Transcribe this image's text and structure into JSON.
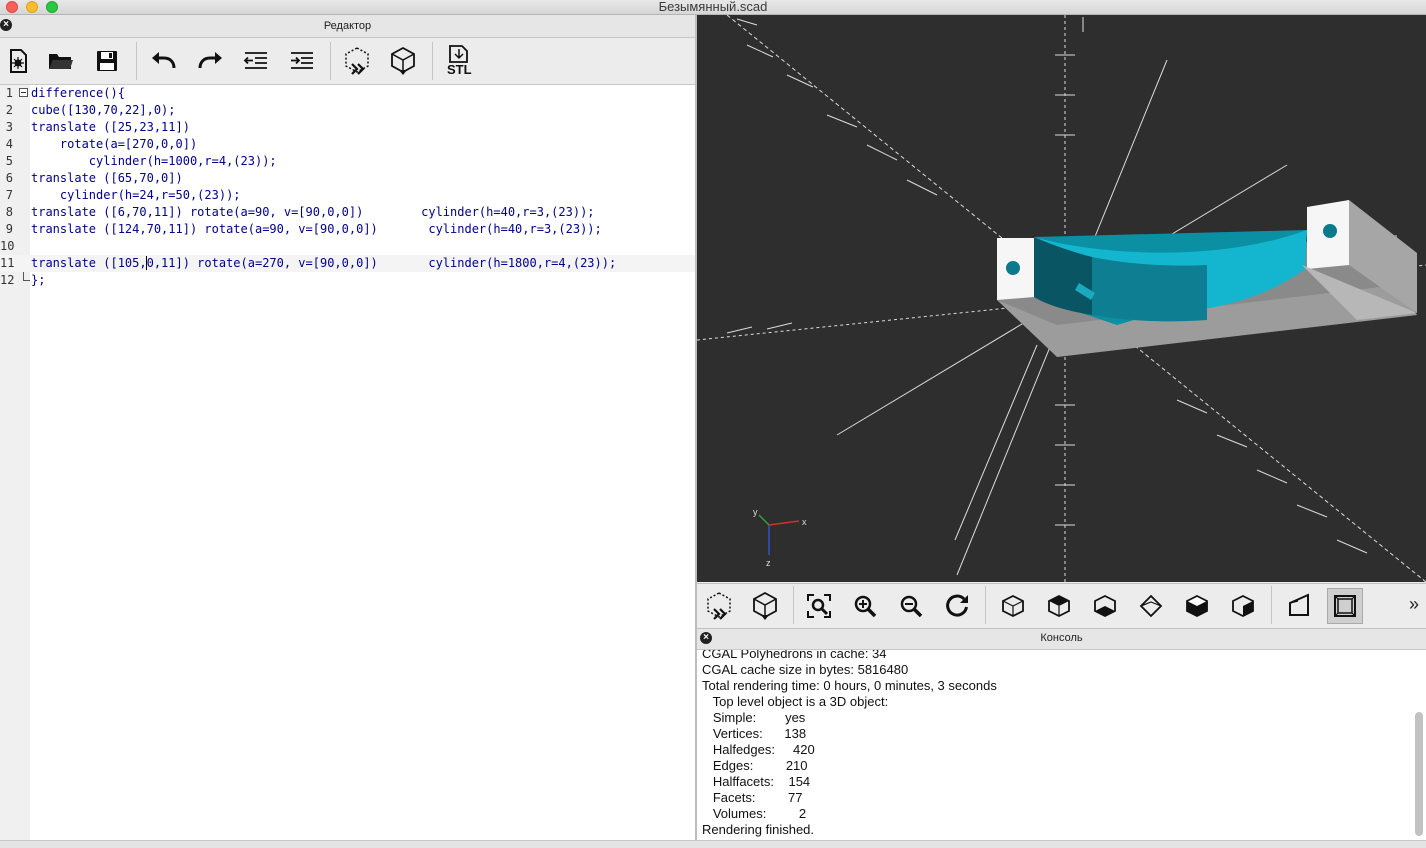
{
  "window": {
    "title": "Безымянный.scad"
  },
  "editor": {
    "title": "Редактор",
    "toolbar": [
      "new-file-icon",
      "open-folder-icon",
      "save-icon",
      "undo-icon",
      "redo-icon",
      "unindent-icon",
      "indent-icon",
      "preview-icon",
      "render-icon",
      "export-stl-icon"
    ],
    "stl_label": "STL",
    "lines": [
      {
        "n": "1",
        "text": "difference(){"
      },
      {
        "n": "2",
        "text": "cube([130,70,22],0);"
      },
      {
        "n": "3",
        "text": "translate ([25,23,11])"
      },
      {
        "n": "4",
        "text": "    rotate(a=[270,0,0])"
      },
      {
        "n": "5",
        "text": "        cylinder(h=1000,r=4,(23));"
      },
      {
        "n": "6",
        "text": "translate ([65,70,0])"
      },
      {
        "n": "7",
        "text": "    cylinder(h=24,r=50,(23));"
      },
      {
        "n": "8",
        "text": "translate ([6,70,11]) rotate(a=90, v=[90,0,0])        cylinder(h=40,r=3,(23));"
      },
      {
        "n": "9",
        "text": "translate ([124,70,11]) rotate(a=90, v=[90,0,0])       cylinder(h=40,r=3,(23));"
      },
      {
        "n": "10",
        "text": ""
      },
      {
        "n": "11",
        "text": "translate ([105,0,11]) rotate(a=270, v=[90,0,0])       cylinder(h=1800,r=4,(23));"
      },
      {
        "n": "12",
        "text": "};"
      }
    ]
  },
  "viewport": {
    "background": "#2e2e2e",
    "axis_x": "x",
    "axis_y": "y",
    "axis_z": "z"
  },
  "view_toolbar": [
    "preview-icon",
    "render-icon",
    "view-all-icon",
    "zoom-in-icon",
    "zoom-out-icon",
    "reset-view-icon",
    "view-right-icon",
    "view-top-icon",
    "view-bottom-icon",
    "view-left-icon",
    "view-front-icon",
    "view-back-icon",
    "perspective-icon",
    "orthogonal-icon"
  ],
  "view_toolbar_more": "»",
  "console": {
    "title": "Консоль",
    "lines": [
      "CGAL Polyhedrons in cache: 34",
      "CGAL cache size in bytes: 5816480",
      "Total rendering time: 0 hours, 0 minutes, 3 seconds",
      "   Top level object is a 3D object:",
      "   Simple:        yes",
      "   Vertices:      138",
      "   Halfedges:     420",
      "   Edges:         210",
      "   Halffacets:    154",
      "   Facets:         77",
      "   Volumes:         2",
      "Rendering finished."
    ]
  },
  "close_glyph": "×"
}
